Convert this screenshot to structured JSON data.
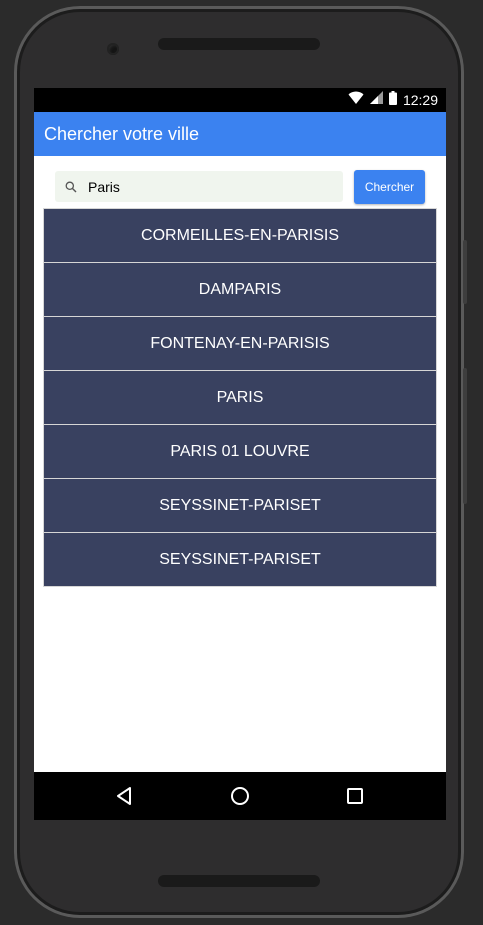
{
  "status_bar": {
    "time": "12:29",
    "icons": [
      "wifi-icon",
      "cell-signal-icon",
      "battery-icon"
    ]
  },
  "app_bar": {
    "title": "Chercher votre ville"
  },
  "search": {
    "value": "Paris",
    "placeholder": "",
    "button_label": "Chercher"
  },
  "results": [
    {
      "label": "CORMEILLES-EN-PARISIS"
    },
    {
      "label": "DAMPARIS"
    },
    {
      "label": "FONTENAY-EN-PARISIS"
    },
    {
      "label": "PARIS"
    },
    {
      "label": "PARIS 01 LOUVRE"
    },
    {
      "label": "SEYSSINET-PARISET"
    },
    {
      "label": "SEYSSINET-PARISET"
    }
  ],
  "nav_bar": {
    "buttons": [
      "back-icon",
      "home-icon",
      "recents-icon"
    ]
  },
  "colors": {
    "accent": "#3b82f0",
    "list_item_bg": "#394160",
    "search_bg": "#f0f5ee"
  }
}
